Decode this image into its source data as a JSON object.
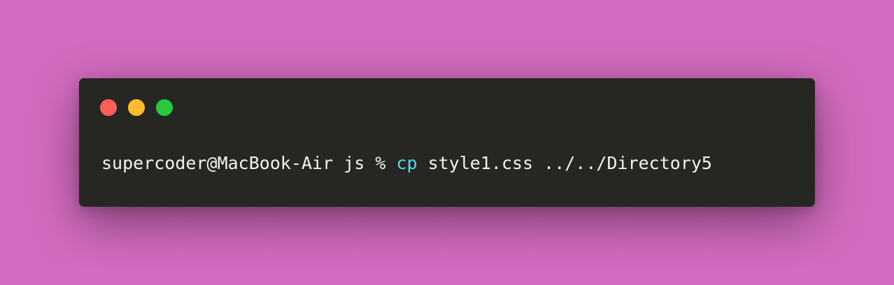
{
  "colors": {
    "background": "#d26bbf",
    "window": "#262723",
    "text": "#f2f2f0",
    "command": "#59d6e7",
    "close": "#ff5f56",
    "minimize": "#ffbd2e",
    "maximize": "#27c93f"
  },
  "window_controls": [
    {
      "name": "close-button",
      "icon": "red-circle"
    },
    {
      "name": "minimize-button",
      "icon": "yellow-circle"
    },
    {
      "name": "maximize-button",
      "icon": "green-circle"
    }
  ],
  "terminal": {
    "prompt": "supercoder@MacBook-Air js % ",
    "command": "cp",
    "arguments": " style1.css ../../Directory5"
  }
}
